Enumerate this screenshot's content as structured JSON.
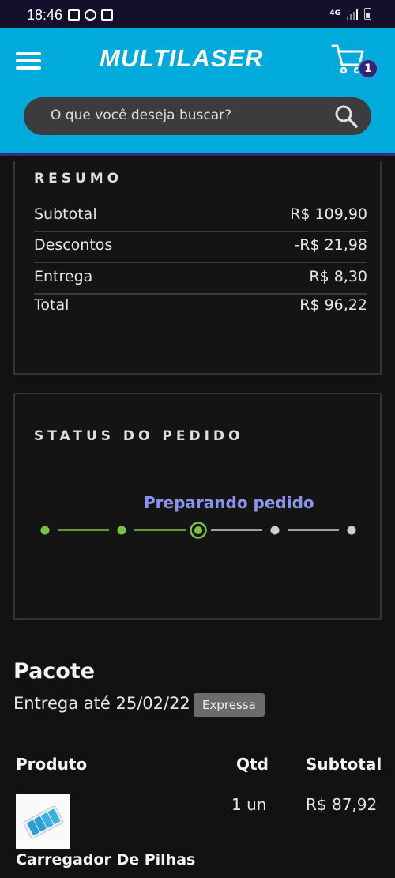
{
  "statusbar": {
    "time": "18:46",
    "network": "4G"
  },
  "header": {
    "logo": "MULTILASER",
    "cart_count": "1",
    "search_placeholder": "O que você deseja buscar?"
  },
  "summary": {
    "title": "RESUMO",
    "rows": [
      {
        "label": "Subtotal",
        "value": "R$ 109,90"
      },
      {
        "label": "Descontos",
        "value": "-R$ 21,98"
      },
      {
        "label": "Entrega",
        "value": "R$ 8,30"
      },
      {
        "label": "Total",
        "value": "R$ 96,22"
      }
    ]
  },
  "order_status": {
    "title": "STATUS DO PEDIDO",
    "current_label": "Preparando pedido",
    "total_steps": 5,
    "current_step": 3,
    "colors": {
      "done": "#7cc242",
      "pending": "#cfcfcf",
      "label": "#8c93ee"
    }
  },
  "package": {
    "title": "Pacote",
    "delivery": "Entrega até 25/02/22",
    "shipping_badge": "Expressa",
    "columns": {
      "product": "Produto",
      "qty": "Qtd",
      "subtotal": "Subtotal"
    },
    "items": [
      {
        "name": "Carregador De Pilhas",
        "qty": "1 un",
        "subtotal": "R$ 87,92"
      }
    ]
  }
}
